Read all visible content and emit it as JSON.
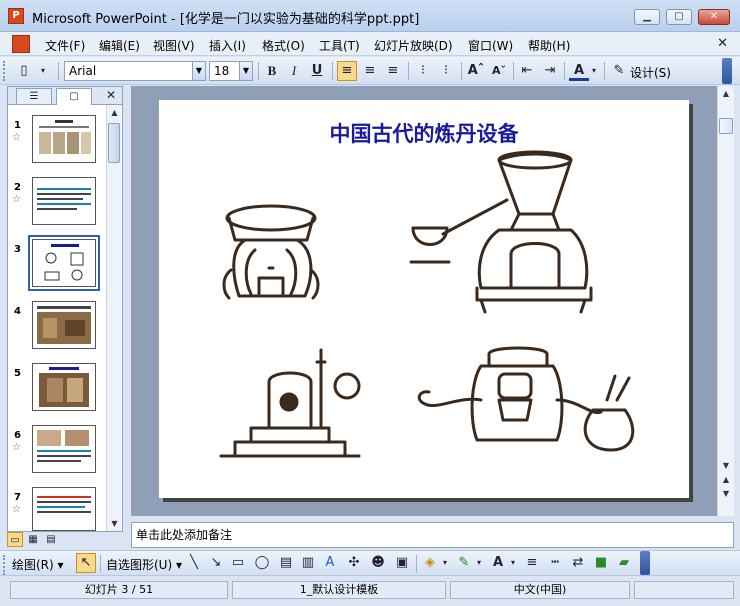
{
  "window": {
    "title": "Microsoft PowerPoint - [化学是一门以实验为基础的科学ppt.ppt]",
    "app_icon": "P",
    "minimize": "▁",
    "maximize": "▢",
    "close": "✕"
  },
  "menu": {
    "items": [
      "文件(F)",
      "编辑(E)",
      "视图(V)",
      "插入(I)",
      "格式(O)",
      "工具(T)",
      "幻灯片放映(D)",
      "窗口(W)",
      "帮助(H)"
    ],
    "close": "✕"
  },
  "toolbar": {
    "font_name": "Arial",
    "font_size": "18",
    "dropdown_arrow": "▼",
    "bold": "B",
    "italic": "I",
    "underline": "U",
    "design_label": "设计(S)"
  },
  "panel": {
    "tab_outline": "☰",
    "tab_slides": "▢",
    "close": "✕",
    "slides": [
      {
        "num": "1",
        "star": "☆"
      },
      {
        "num": "2",
        "star": "☆"
      },
      {
        "num": "3",
        "star": ""
      },
      {
        "num": "4",
        "star": ""
      },
      {
        "num": "5",
        "star": ""
      },
      {
        "num": "6",
        "star": "☆"
      },
      {
        "num": "7",
        "star": "☆"
      }
    ]
  },
  "slide": {
    "title": "中国古代的炼丹设备"
  },
  "notes": {
    "placeholder": "单击此处添加备注"
  },
  "drawing": {
    "draw_label": "绘图(R) ▾",
    "autoshapes_label": "自选图形(U) ▾"
  },
  "status": {
    "slide_info": "幻灯片 3 / 51",
    "template": "1_默认设计模板",
    "language": "中文(中国)"
  },
  "colors": {
    "accent": "#2d61b8",
    "title_blue": "#1a1a9c",
    "sketch": "#3a2a1e"
  }
}
